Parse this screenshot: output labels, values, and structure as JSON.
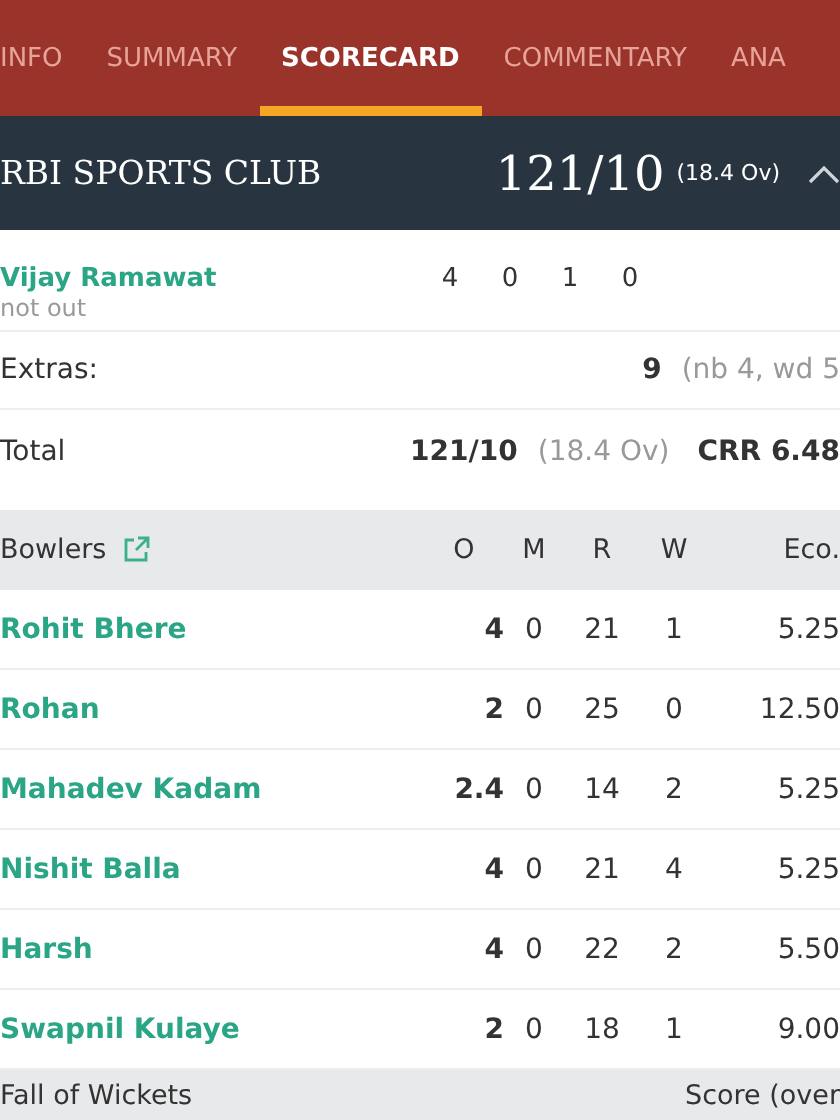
{
  "tabs": [
    {
      "label": "INFO",
      "selected": false
    },
    {
      "label": "SUMMARY",
      "selected": false
    },
    {
      "label": "SCORECARD",
      "selected": true
    },
    {
      "label": "COMMENTARY",
      "selected": false
    },
    {
      "label": "ANA",
      "selected": false
    }
  ],
  "innings": {
    "team": "RBI SPORTS CLUB",
    "score": "121/10",
    "overs": "(18.4 Ov)",
    "expanded": true
  },
  "batsman": {
    "name": "Vijay Ramawat",
    "status": "not out",
    "stats": [
      "4",
      "0",
      "1",
      "0"
    ]
  },
  "extras": {
    "label": "Extras:",
    "value": "9",
    "detail": "(nb 4, wd 5"
  },
  "total": {
    "label": "Total",
    "score": "121/10",
    "overs": "(18.4 Ov)",
    "rate": "CRR 6.48"
  },
  "bowlers": {
    "title": "Bowlers",
    "columns": [
      "O",
      "M",
      "R",
      "W",
      "Eco."
    ],
    "rows": [
      {
        "name": "Rohit Bhere",
        "values": [
          "4",
          "0",
          "21",
          "1",
          "5.25"
        ]
      },
      {
        "name": "Rohan",
        "values": [
          "2",
          "0",
          "25",
          "0",
          "12.50"
        ]
      },
      {
        "name": "Mahadev Kadam",
        "values": [
          "2.4",
          "0",
          "14",
          "2",
          "5.25"
        ]
      },
      {
        "name": "Nishit Balla",
        "values": [
          "4",
          "0",
          "21",
          "4",
          "5.25"
        ]
      },
      {
        "name": "Harsh",
        "values": [
          "4",
          "0",
          "22",
          "2",
          "5.50"
        ]
      },
      {
        "name": "Swapnil Kulaye",
        "values": [
          "2",
          "0",
          "18",
          "1",
          "9.00"
        ]
      }
    ]
  },
  "fall_of_wickets": {
    "title": "Fall of Wickets",
    "column": "Score (over"
  }
}
